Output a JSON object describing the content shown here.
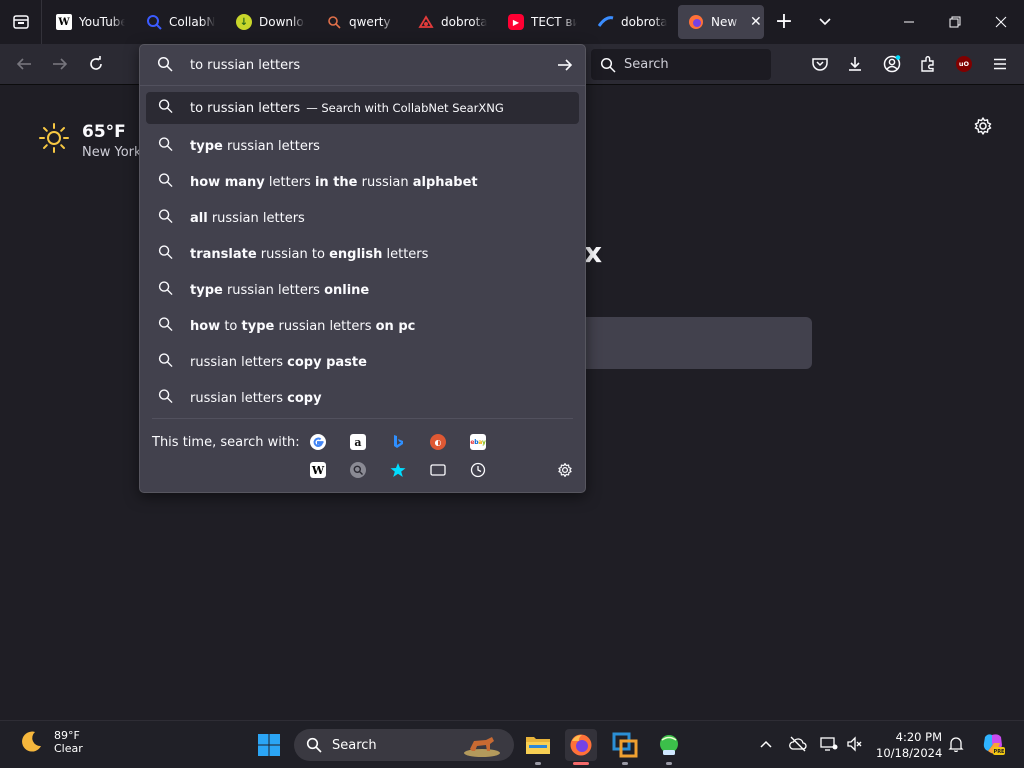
{
  "tabs": [
    {
      "title": "YouTube",
      "favicon": "wikipedia-icon"
    },
    {
      "title": "CollabNet",
      "favicon": "searxng-icon"
    },
    {
      "title": "Download",
      "favicon": "download-site-icon"
    },
    {
      "title": "qwerty",
      "favicon": "search-icon"
    },
    {
      "title": "dobrota",
      "favicon": "dobrota-icon"
    },
    {
      "title": "ТЕСТ ви",
      "favicon": "youtube-icon"
    },
    {
      "title": "dobrota",
      "favicon": "dobrota-wave-icon"
    },
    {
      "title": "New T",
      "favicon": "firefox-icon",
      "active": true
    }
  ],
  "navbar": {
    "search_placeholder": "Search"
  },
  "urlbar": {
    "value": "to russian letters",
    "heuristic": {
      "text": "to russian letters",
      "action": "— Search with CollabNet SearXNG"
    },
    "suggestions": [
      [
        {
          "t": "type",
          "b": true
        },
        {
          "t": " russian letters",
          "b": false
        }
      ],
      [
        {
          "t": "how many",
          "b": true
        },
        {
          "t": " letters ",
          "b": false
        },
        {
          "t": "in the",
          "b": true
        },
        {
          "t": " russian ",
          "b": false
        },
        {
          "t": "alphabet",
          "b": true
        }
      ],
      [
        {
          "t": "all",
          "b": true
        },
        {
          "t": " russian letters",
          "b": false
        }
      ],
      [
        {
          "t": "translate",
          "b": true
        },
        {
          "t": " russian to ",
          "b": false
        },
        {
          "t": "english",
          "b": true
        },
        {
          "t": " letters",
          "b": false
        }
      ],
      [
        {
          "t": "type",
          "b": true
        },
        {
          "t": " russian letters ",
          "b": false
        },
        {
          "t": "online",
          "b": true
        }
      ],
      [
        {
          "t": "how",
          "b": true
        },
        {
          "t": " to ",
          "b": false
        },
        {
          "t": "type",
          "b": true
        },
        {
          "t": " russian letters ",
          "b": false
        },
        {
          "t": "on pc",
          "b": true
        }
      ],
      [
        {
          "t": "russian letters ",
          "b": false
        },
        {
          "t": "copy paste",
          "b": true
        }
      ],
      [
        {
          "t": "russian letters ",
          "b": false
        },
        {
          "t": "copy",
          "b": true
        }
      ]
    ],
    "oneoff_label": "This time, search with:",
    "oneoff_engines": [
      "google-icon",
      "amazon-icon",
      "bing-icon",
      "duckduckgo-icon",
      "ebay-icon",
      "wikipedia-icon",
      "searxng-icon",
      "bookmarks-star-icon",
      "tabs-icon",
      "history-icon"
    ]
  },
  "newtab": {
    "temperature": "65°F",
    "city": "New York",
    "logo_fragment": "x"
  },
  "taskbar": {
    "weather_temp": "89°F",
    "weather_desc": "Clear",
    "search_label": "Search",
    "time": "4:20 PM",
    "date": "10/18/2024"
  },
  "colors": {
    "tabstrip": "#1c1b22",
    "toolbar": "#2b2a33",
    "dropdown": "#42414d",
    "page": "#1f1e25"
  }
}
